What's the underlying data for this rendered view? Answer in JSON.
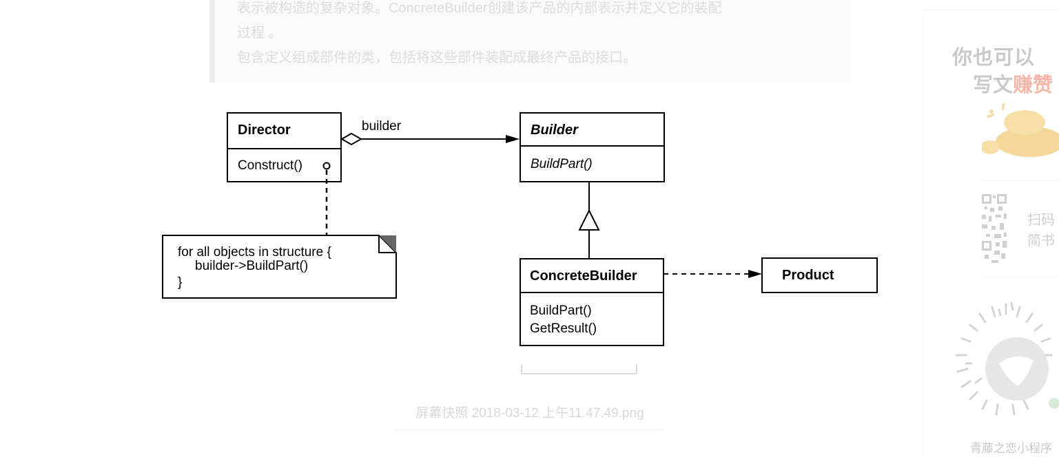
{
  "article": {
    "quote_lines": [
      "表示被构造的复杂对象。ConcreteBuilder创建该产品的内部表示并定义它的装配",
      "过程 。",
      "包含定义组成部件的类，包括将这些部件装配成最终产品的接口。"
    ],
    "figure_caption": "屏幕快照 2018-03-12 上午11.47.49.png"
  },
  "diagram": {
    "director": {
      "name": "Director",
      "method": "Construct()"
    },
    "builder_assoc_label": "builder",
    "builder": {
      "name": "Builder",
      "method": "BuildPart()"
    },
    "note": {
      "line1": "for all objects in structure {",
      "line2": "builder->BuildPart()",
      "line3": "}"
    },
    "concrete_builder": {
      "name": "ConcreteBuilder",
      "method1": "BuildPart()",
      "method2": "GetResult()"
    },
    "product": {
      "name": "Product"
    }
  },
  "sidebar": {
    "ad_line1": "你也可以",
    "ad_line2_prefix": "写文",
    "ad_line2_highlight": "赚赞",
    "scan_line1": "扫码",
    "scan_line2": "简书",
    "qr_label": "青藤之恋小程序"
  },
  "colors": {
    "highlight": "#f4b6a9",
    "faded_text": "#dcdcdc",
    "coin": "#f6d79a"
  }
}
